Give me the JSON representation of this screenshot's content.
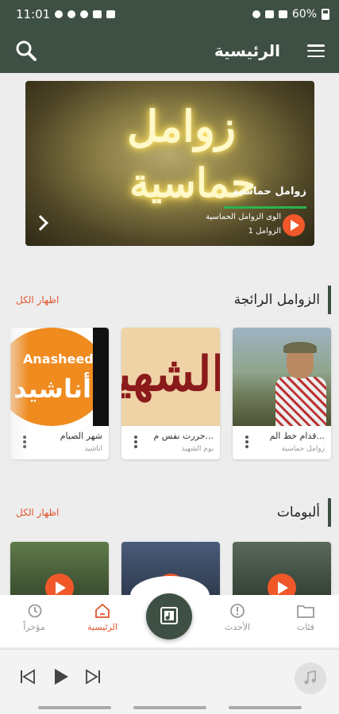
{
  "status_bar": {
    "time": "11:01",
    "battery": "60%"
  },
  "app_bar": {
    "title": "الرئيسية",
    "search_icon": "search-icon",
    "menu_icon": "hamburger-menu-icon"
  },
  "banner": {
    "title": "زوامل حماسية",
    "subtitle": "الوى الزوامل الحماسية",
    "count": "1 الزوامل",
    "art_line1": "زوامل",
    "art_line2": "حماسية"
  },
  "trending": {
    "title": "الزوامل الرائجة",
    "show_all": "اظهار الكل",
    "items": [
      {
        "title": "قدام خط الم...",
        "subtitle": "زوامل حماسية"
      },
      {
        "title": "حررت نفس م...",
        "subtitle": "يوم الشهيد",
        "art_text": "الشهيد"
      },
      {
        "title": "شهر الصيام",
        "subtitle": "اناشيد",
        "art_en": "Anasheed",
        "art_ar": "أناشيد"
      }
    ]
  },
  "albums": {
    "title": "ألبومات",
    "show_all": "اظهار الكل"
  },
  "bottom_nav": {
    "items": [
      {
        "label": "فئات"
      },
      {
        "label": "الأحدث"
      },
      {
        "label": "الرئيسية"
      },
      {
        "label": "مؤخراً"
      }
    ]
  },
  "colors": {
    "primary": "#3e4f44",
    "accent": "#e2562d",
    "play": "#f0582a"
  }
}
